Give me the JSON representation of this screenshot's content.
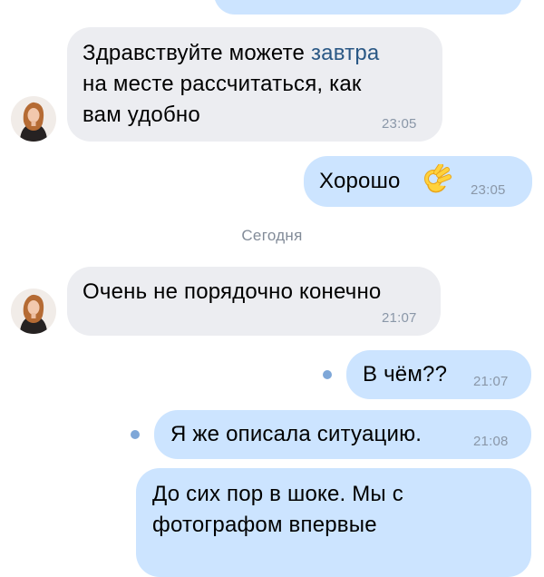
{
  "chat": {
    "date_separator": "Сегодня",
    "messages": [
      {
        "direction": "incoming",
        "lines": [
          {
            "before": "Здравствуйте можете ",
            "link": "завтра"
          },
          "на месте рассчитаться,  как",
          "вам удобно"
        ],
        "time": "23:05"
      },
      {
        "direction": "outgoing",
        "text": "Хорошо",
        "emoji": "ok-hand-emoji",
        "time": "23:05"
      },
      {
        "direction": "incoming",
        "text": "Очень не порядочно конечно",
        "time": "21:07"
      },
      {
        "direction": "outgoing",
        "text": "В чём??",
        "time": "21:07",
        "unread": true
      },
      {
        "direction": "outgoing",
        "text": "Я же описала ситуацию.",
        "time": "21:08",
        "unread": true
      },
      {
        "direction": "outgoing",
        "lines": [
          "До сих пор в шоке. Мы с",
          "фотографом впервые"
        ]
      }
    ]
  },
  "colors": {
    "incoming_bubble": "#ecedf1",
    "outgoing_bubble": "#cce4ff",
    "link": "#2a5885",
    "timestamp": "#8a97a8",
    "unread_dot": "#7ea7d8"
  }
}
